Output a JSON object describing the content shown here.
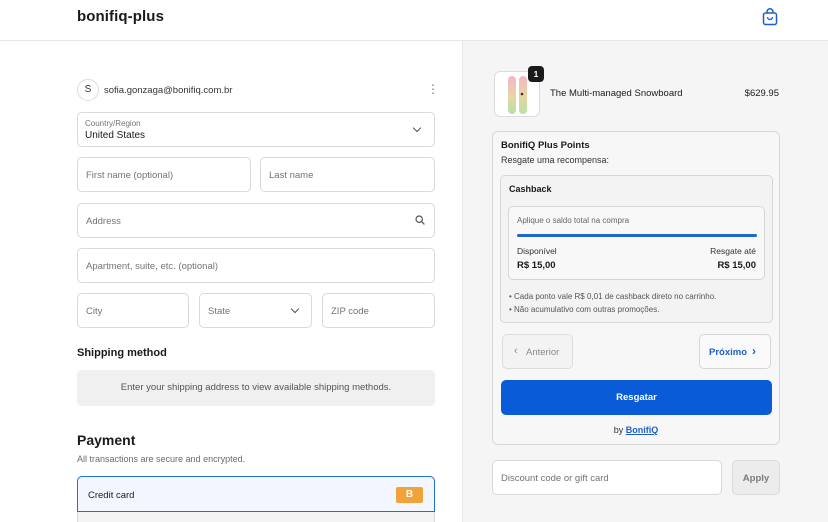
{
  "header": {
    "brand": "bonifiq-plus",
    "cart_icon": "shopping-bag-icon"
  },
  "account": {
    "avatar_initial": "S",
    "email": "sofia.gonzaga@bonifiq.com.br",
    "menu_icon": "kebab-menu-icon"
  },
  "form": {
    "country_label": "Country/Region",
    "country_value": "United States",
    "first_name_placeholder": "First name (optional)",
    "last_name_placeholder": "Last name",
    "address_placeholder": "Address",
    "apartment_placeholder": "Apartment, suite, etc. (optional)",
    "city_placeholder": "City",
    "state_placeholder": "State",
    "zip_placeholder": "ZIP code"
  },
  "shipping": {
    "title": "Shipping method",
    "note": "Enter your shipping address to view available shipping methods."
  },
  "payment": {
    "title": "Payment",
    "subtitle": "All transactions are secure and encrypted.",
    "method_label": "Credit card",
    "badge_text": "B",
    "badge_color": "#f2a23a"
  },
  "cart": {
    "quantity": "1",
    "product_name": "The Multi-managed Snowboard",
    "price": "$629.95"
  },
  "points": {
    "title": "BonifiQ Plus Points",
    "subtitle": "Resgate uma recompensa:",
    "reward_title": "Cashback",
    "hint": "Aplique o saldo total na compra",
    "progress": 1.0,
    "available_label": "Disponível",
    "available_value": "R$ 15,00",
    "max_label": "Resgate até",
    "max_value": "R$ 15,00",
    "note_1": "• Cada ponto vale R$ 0,01 de cashback direto no carrinho.",
    "note_2": "• Não acumulativo com outras promoções.",
    "prev_label": "Anterior",
    "next_label": "Próximo",
    "redeem_label": "Resgatar",
    "by_prefix": "by",
    "by_link": "BonifiQ",
    "accent_color": "#0a5bd8"
  },
  "discount": {
    "placeholder": "Discount code or gift card",
    "apply_label": "Apply"
  }
}
